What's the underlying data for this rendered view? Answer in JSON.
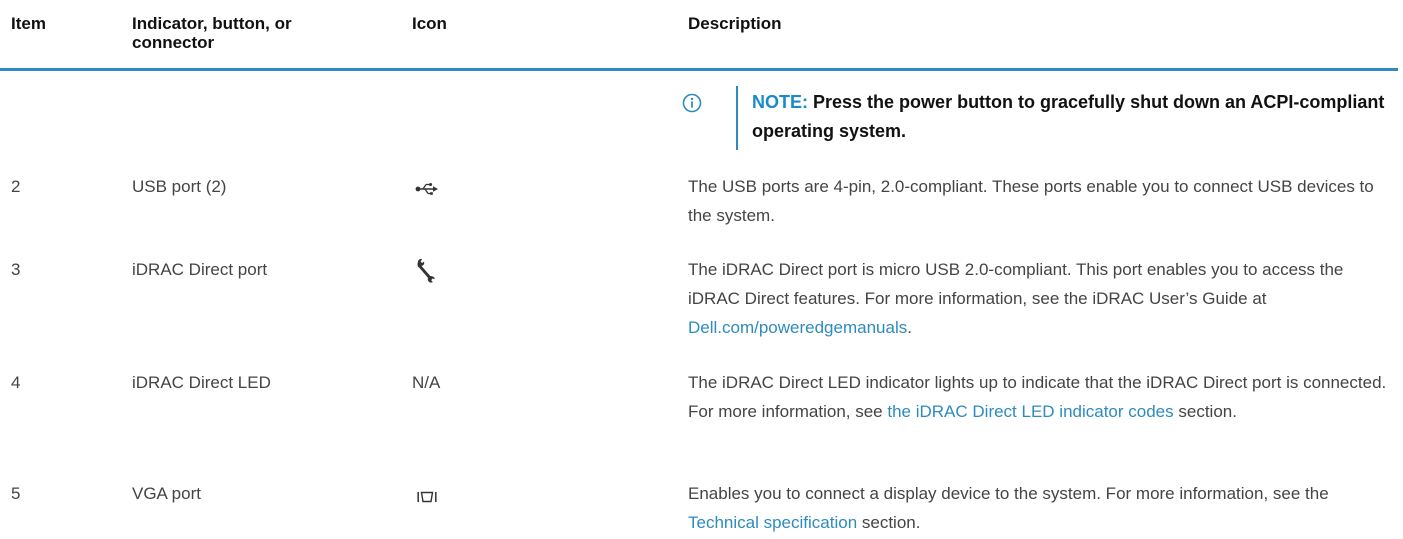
{
  "headers": {
    "item": "Item",
    "indicator": "Indicator, button, or connector",
    "icon": "Icon",
    "description": "Description"
  },
  "note": {
    "label": "NOTE:",
    "text": "Press the power button to gracefully shut down an ACPI-compliant operating system.",
    "icon": "info-icon"
  },
  "rows": [
    {
      "item": "2",
      "indicator": "USB port (2)",
      "icon": "usb-icon",
      "description": "The USB ports are 4-pin, 2.0-compliant. These ports enable you to connect USB devices to the system."
    },
    {
      "item": "3",
      "indicator": "iDRAC Direct port",
      "icon": "wrench-icon",
      "description_pre": "The iDRAC Direct port is micro USB 2.0-compliant. This port enables you to access the iDRAC Direct features. For more information, see the iDRAC User’s Guide at ",
      "description_link": "Dell.com/poweredgemanuals",
      "description_post": "."
    },
    {
      "item": "4",
      "indicator": "iDRAC Direct LED",
      "icon_text": "N/A",
      "description_pre": "The iDRAC Direct LED indicator lights up to indicate that the iDRAC Direct port is connected. For more information, see ",
      "description_link": "the iDRAC Direct LED indicator codes",
      "description_post": " section."
    },
    {
      "item": "5",
      "indicator": "VGA port",
      "icon": "vga-icon",
      "description_pre": "Enables you to connect a display device to the system. For more information, see the ",
      "description_link": "Technical specification",
      "description_post": " section."
    }
  ],
  "colors": {
    "accent": "#2d8bbf",
    "text": "#444444",
    "heading": "#111111"
  }
}
